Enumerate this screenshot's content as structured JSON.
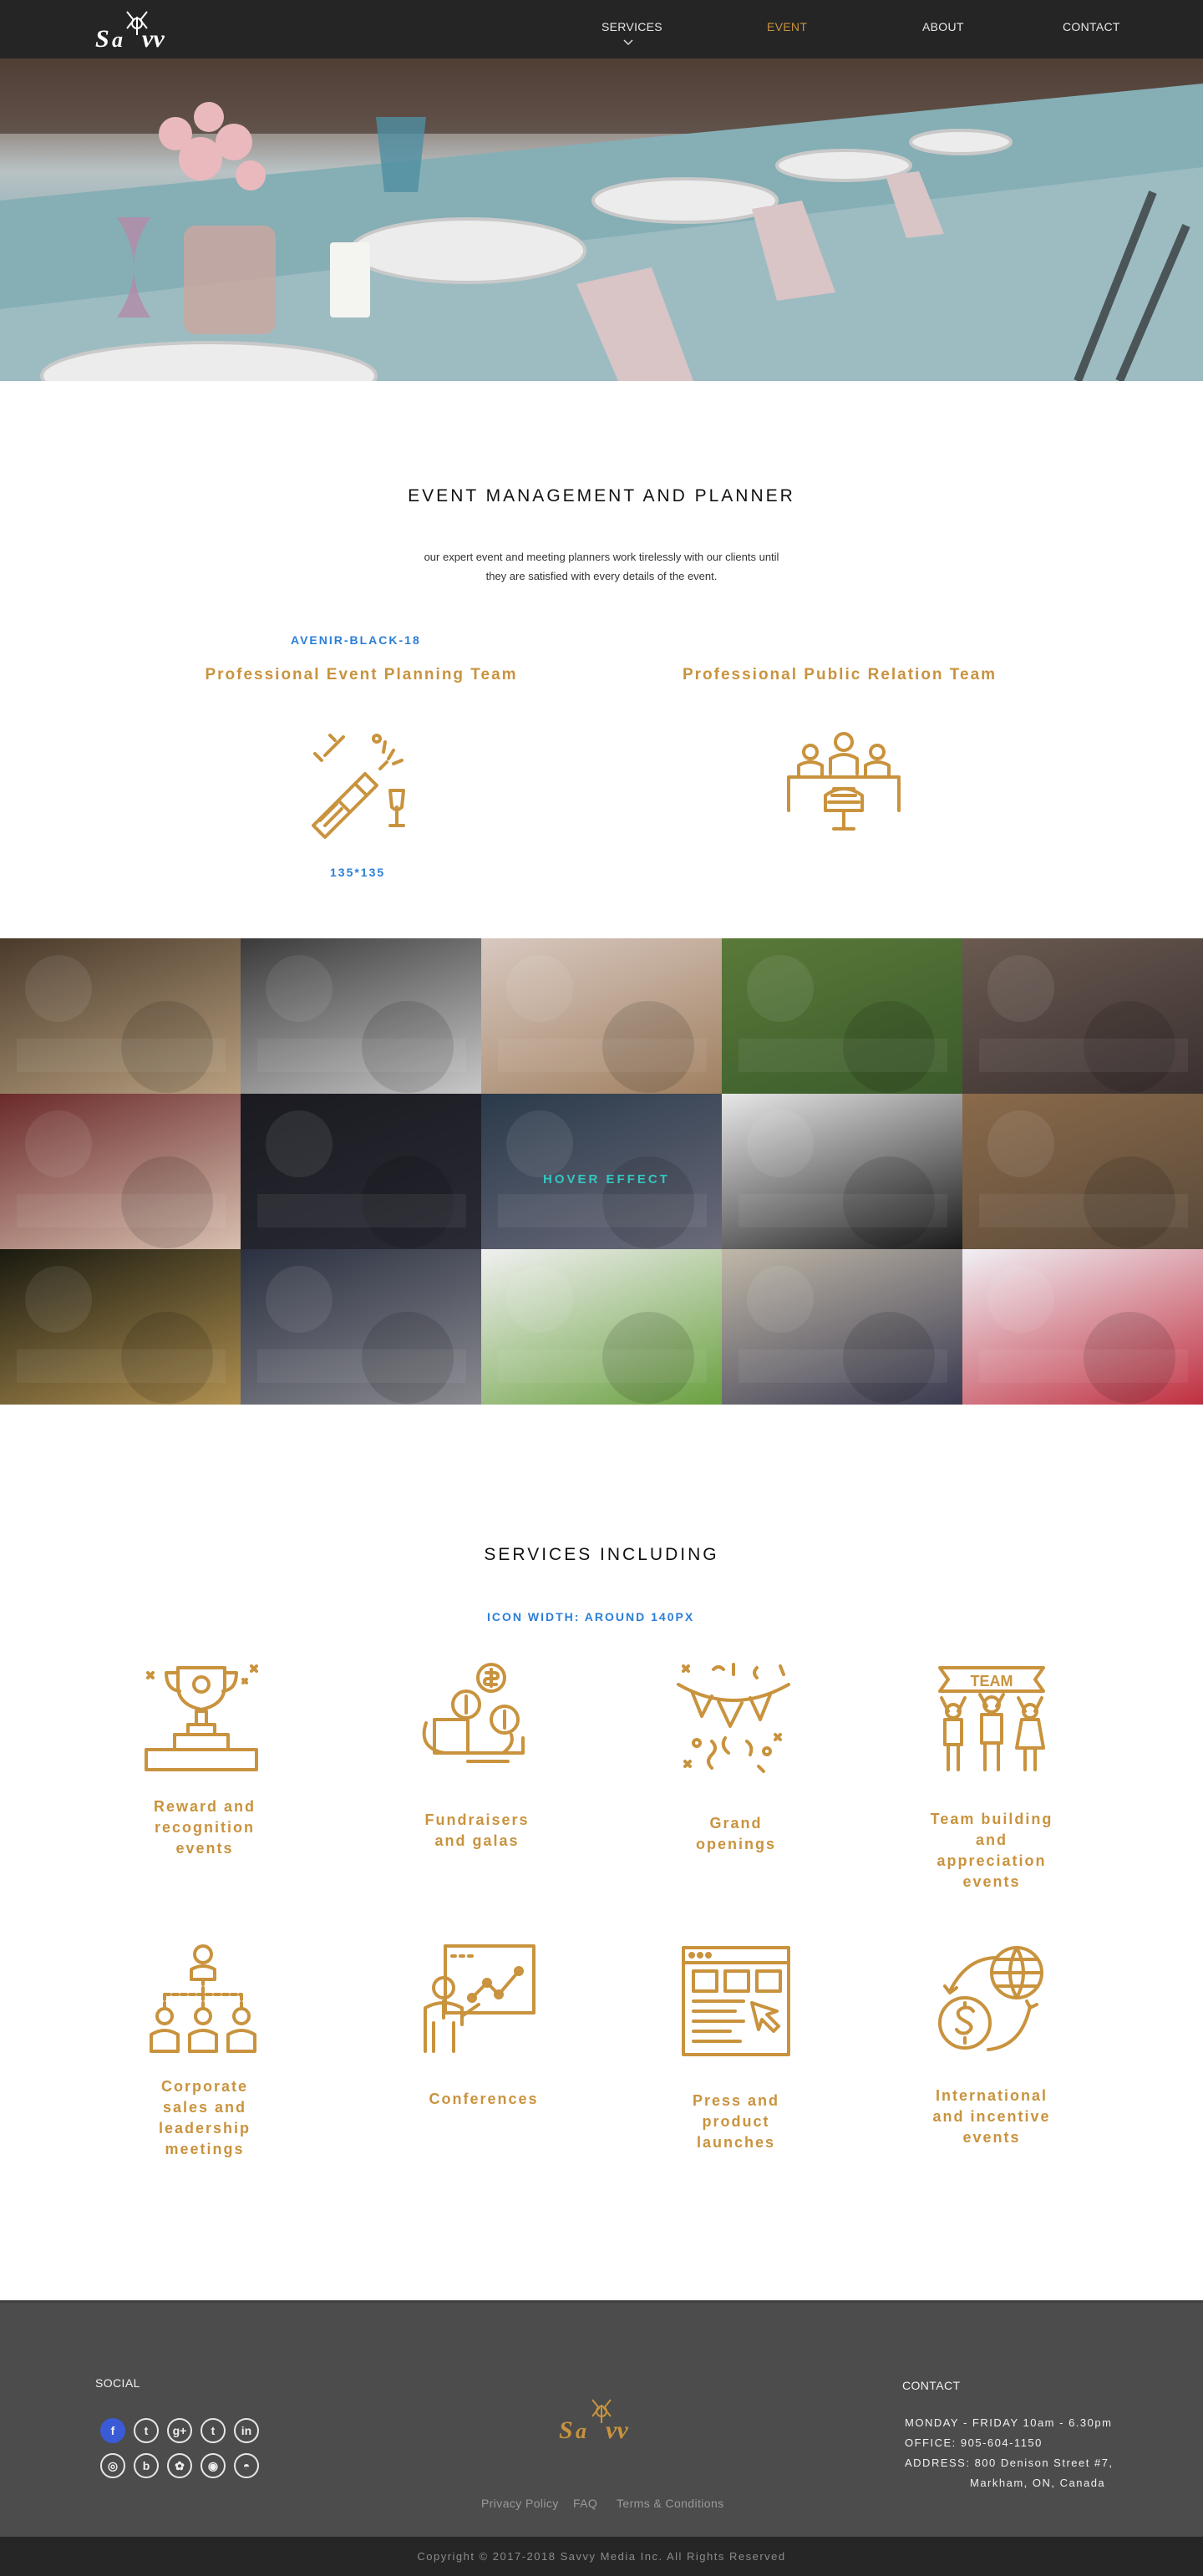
{
  "nav": {
    "brand": "SAVVY",
    "items": [
      {
        "label": "SERVICES"
      },
      {
        "label": "EVENT"
      },
      {
        "label": "ABOUT"
      },
      {
        "label": "CONTACT"
      }
    ],
    "active_color": "#c9933e"
  },
  "intro": {
    "heading": "EVENT MANAGEMENT AND PLANNER",
    "paragraph_line1": "our expert event and meeting planners work tirelessly with our clients until",
    "paragraph_line2": "they are satisfied with every details of the event.",
    "font_note": "AVENIR-BLACK-18",
    "size_note": "135*135",
    "team_left": "Professional Event Planning Team",
    "team_right": "Professional Public Relation Team"
  },
  "gallery": {
    "hover_label": "HOVER EFFECT",
    "tiles": [
      {
        "name": "banquet-chairs",
        "colors": [
          "#4a3a2a",
          "#b8a080"
        ]
      },
      {
        "name": "conference-table",
        "colors": [
          "#3a3a3a",
          "#c8c8c8"
        ]
      },
      {
        "name": "table-setting-flowers",
        "colors": [
          "#d8c8c0",
          "#a08060"
        ]
      },
      {
        "name": "garden-party",
        "colors": [
          "#5a7a3a",
          "#3a5a2a"
        ]
      },
      {
        "name": "audience",
        "colors": [
          "#6a5a50",
          "#3a3030"
        ]
      },
      {
        "name": "catering-appetizers",
        "colors": [
          "#6a2a2a",
          "#d8c0b0"
        ]
      },
      {
        "name": "new-year-invitation",
        "colors": [
          "#1a1a20",
          "#2a2a35"
        ]
      },
      {
        "name": "crowd-event",
        "colors": [
          "#2a3a4a",
          "#6a6a7a"
        ]
      },
      {
        "name": "cocktail-cards",
        "colors": [
          "#e8e8e8",
          "#1a1a1a"
        ]
      },
      {
        "name": "reception-crowd",
        "colors": [
          "#8a6a4a",
          "#5a4a3a"
        ]
      },
      {
        "name": "perfume-bottles",
        "colors": [
          "#1a1a10",
          "#b09050"
        ]
      },
      {
        "name": "venue-interior",
        "colors": [
          "#2a3040",
          "#8a8a90"
        ]
      },
      {
        "name": "plate-napkin",
        "colors": [
          "#f0f0f0",
          "#6aa040"
        ]
      },
      {
        "name": "buffet-table",
        "colors": [
          "#c0b8a8",
          "#3a3a50"
        ]
      },
      {
        "name": "robot-cake",
        "colors": [
          "#f0f0f5",
          "#c03040"
        ]
      }
    ]
  },
  "services": {
    "heading": "SERVICES INCLUDING",
    "note": "ICON WIDTH: AROUND 140PX",
    "items": [
      {
        "line1": "Reward and",
        "line2": "recognition",
        "line3": "events",
        "line4": ""
      },
      {
        "line1": "Fundraisers",
        "line2": "and galas",
        "line3": "",
        "line4": ""
      },
      {
        "line1": "Grand",
        "line2": "openings",
        "line3": "",
        "line4": ""
      },
      {
        "line1": "Team building",
        "line2": "and",
        "line3": "appreciation",
        "line4": "events"
      },
      {
        "line1": "Corporate",
        "line2": "sales and",
        "line3": "leadership",
        "line4": "meetings"
      },
      {
        "line1": "Conferences",
        "line2": "",
        "line3": "",
        "line4": ""
      },
      {
        "line1": "Press and",
        "line2": "product",
        "line3": "launches",
        "line4": ""
      },
      {
        "line1": "International",
        "line2": "and incentive",
        "line3": "events",
        "line4": ""
      }
    ],
    "team_banner": "TEAM"
  },
  "footer": {
    "social_heading": "SOCIAL",
    "social_icons": [
      "f",
      "t",
      "g+",
      "t",
      "in",
      "◎",
      "b",
      "✿",
      "◉",
      "◓"
    ],
    "social_icon_names": [
      "facebook-icon",
      "twitter-icon",
      "google-plus-icon",
      "tumblr-icon",
      "linkedin-icon",
      "instagram-icon",
      "bilibili-icon",
      "flower-icon",
      "weibo-icon",
      "wechat-icon"
    ],
    "contact_heading": "CONTACT",
    "hours": "MONDAY - FRIDAY 10am - 6.30pm",
    "office": "OFFICE:  905-604-1150",
    "address1": "ADDRESS: 800 Denison Street #7,",
    "address2": "Markham, ON, Canada",
    "links": [
      "Privacy Policy",
      "FAQ",
      "Terms & Conditions"
    ],
    "copyright": "Copyright © 2017-2018  Savvy Media Inc. All Rights Reserved"
  }
}
